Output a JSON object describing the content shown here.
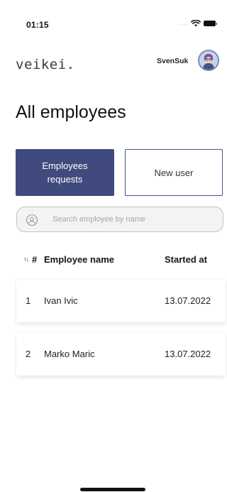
{
  "status_bar": {
    "time": "01:15",
    "signal_dots": "....",
    "icons": [
      "wifi-icon",
      "battery-icon"
    ]
  },
  "header": {
    "logo": "veikei.",
    "username": "SvenSuk",
    "avatar_icon": "user-avatar"
  },
  "page_title": "All employees",
  "actions": {
    "requests_label": "Employees requests",
    "new_user_label": "New user"
  },
  "search": {
    "placeholder": "Search employee by name",
    "value": "",
    "icon": "search-icon"
  },
  "table": {
    "sort_icon": "↑↓",
    "headers": {
      "number": "#",
      "name": "Employee name",
      "started": "Started at"
    },
    "rows": [
      {
        "number": "1",
        "name": "Ivan Ivic",
        "started": "13.07.2022"
      },
      {
        "number": "2",
        "name": "Marko Maric",
        "started": "13.07.2022"
      }
    ]
  },
  "colors": {
    "primary": "#414a7e",
    "border": "#4a5180",
    "search_bg": "#f3f3f3"
  }
}
